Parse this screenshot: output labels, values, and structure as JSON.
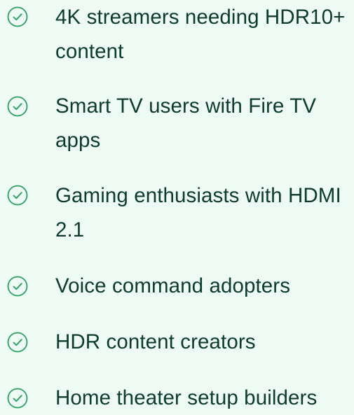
{
  "features": {
    "items": [
      {
        "label": "4K streamers needing HDR10+ content",
        "icon": "check-circle-icon"
      },
      {
        "label": "Smart TV users with Fire TV apps",
        "icon": "check-circle-icon"
      },
      {
        "label": "Gaming enthusiasts with HDMI 2.1",
        "icon": "check-circle-icon"
      },
      {
        "label": "Voice command adopters",
        "icon": "check-circle-icon"
      },
      {
        "label": "HDR content creators",
        "icon": "check-circle-icon"
      },
      {
        "label": "Home theater setup builders",
        "icon": "check-circle-icon"
      }
    ]
  },
  "colors": {
    "background": "#eefaf4",
    "icon": "#2e9e63",
    "text": "#0e3b2f"
  }
}
